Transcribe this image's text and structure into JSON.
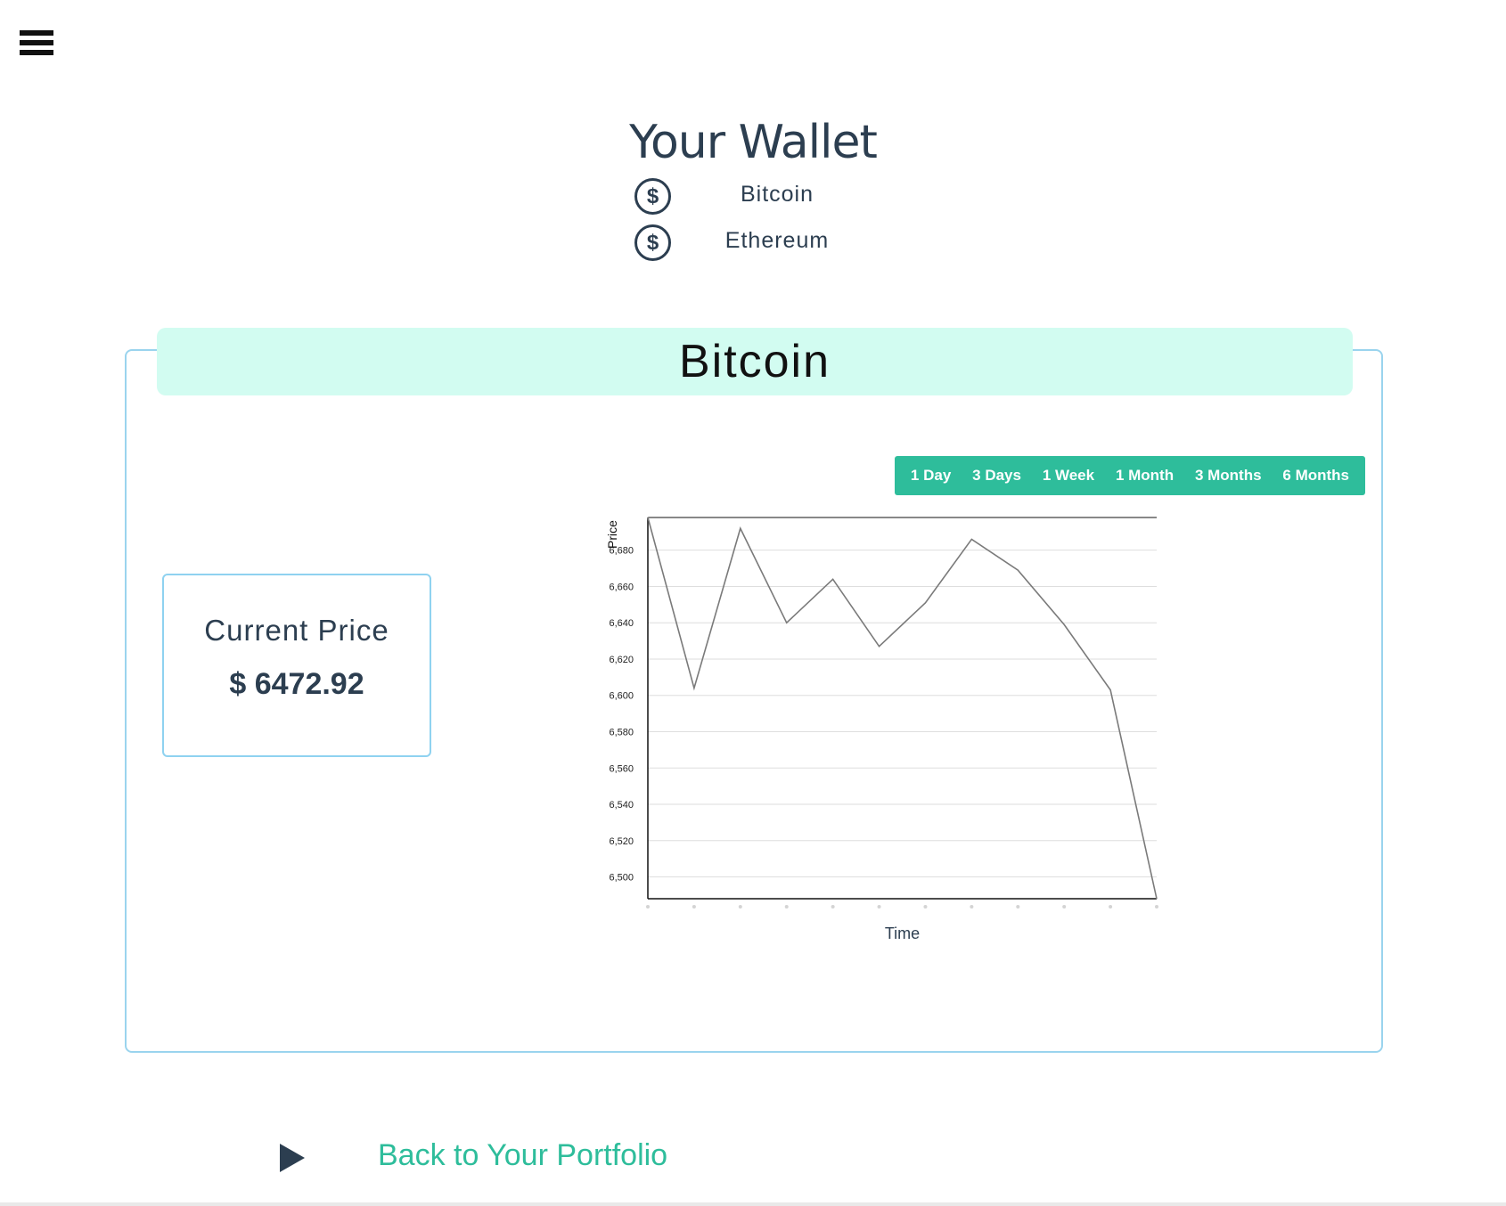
{
  "nav": {
    "menu_icon": "hamburger-menu-icon"
  },
  "wallet": {
    "title": "Your Wallet",
    "items": [
      {
        "label": "Bitcoin",
        "icon": "dollar-coin-icon",
        "glyph": "$"
      },
      {
        "label": "Ethereum",
        "icon": "dollar-coin-icon",
        "glyph": "$"
      }
    ]
  },
  "coin_panel": {
    "title": "Bitcoin",
    "current_price_label": "Current Price",
    "current_price_value": "$ 6472.92",
    "ranges": [
      "1 Day",
      "3 Days",
      "1 Week",
      "1 Month",
      "3 Months",
      "6 Months"
    ]
  },
  "chart_data": {
    "type": "line",
    "title": "",
    "xlabel": "Time",
    "ylabel": "Price",
    "y_ticks": [
      "6,500",
      "6,520",
      "6,540",
      "6,560",
      "6,580",
      "6,600",
      "6,620",
      "6,640",
      "6,660",
      "6,680"
    ],
    "ylim": [
      6488,
      6698
    ],
    "x_count": 12,
    "grid": true,
    "series": [
      {
        "values": [
          6698,
          6604,
          6692,
          6640,
          6664,
          6627,
          6651,
          6686,
          6669,
          6639,
          6603,
          6488
        ]
      }
    ],
    "colors": {
      "line": "#7a7a7a",
      "grid": "#dedede",
      "axis": "#111111"
    }
  },
  "footer": {
    "back_label": "Back to Your Portfolio",
    "back_icon": "play-arrow-icon"
  },
  "colors": {
    "accent": "#2ebd9b",
    "banner": "#d2fcf1",
    "text": "#2c3e50",
    "border": "#9ad4ee"
  }
}
